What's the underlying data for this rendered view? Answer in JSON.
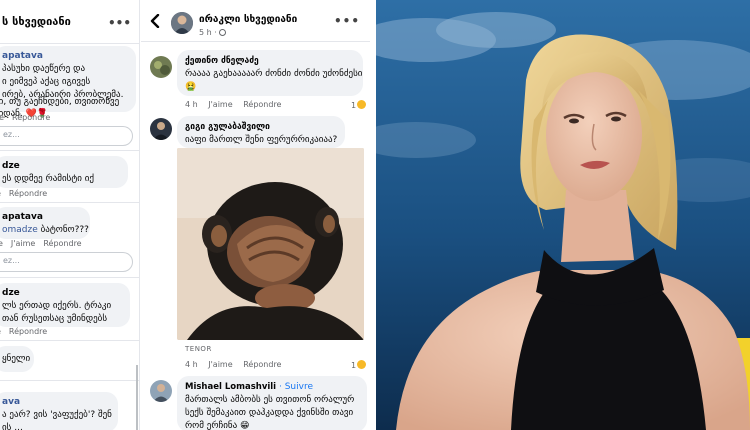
{
  "left": {
    "header_name": "ს სხვედიანი",
    "more": "•••",
    "comments": [
      {
        "who": "apatava",
        "lines": [
          "პასუხი დაეწერე და",
          "ი ეიმვეპ აქაც იგივეს",
          "ირებ, არანაირი პრობლემა.",
          "ბი, თუ გაეჩნდები, თვითონვე",
          "ეიდან."
        ],
        "emoji": "❤️🌹"
      },
      {
        "who": "dze",
        "lines": [
          "ეს დდმეე რამისტი იქ"
        ]
      },
      {
        "who": "apatava",
        "mention": "omadze",
        "lines": [
          "ბატონო???"
        ]
      },
      {
        "who": "dze",
        "lines": [
          "ლს ერთად იქერს. ტრაკი",
          "თან რუსეთსაც უმინდებს"
        ]
      },
      {
        "who": "ყნელი",
        "lines": []
      },
      {
        "who": "ava",
        "lines": [
          "ა ეარ? ვის 'ვაფუქებ'? შენ",
          "ის ..."
        ]
      }
    ],
    "actions": {
      "like": "J'aime",
      "reply": "Répondre"
    },
    "reply_placeholder": "ez..."
  },
  "mid": {
    "header": {
      "name": "ირაკლი სხვედიანი",
      "time": "5 h",
      "more": "•••"
    },
    "comments": [
      {
        "who": "ქეთინო ძნელაძე",
        "lines": [
          "რაააა გაეხააააარ ძონძი ძონძი უძონძესი"
        ],
        "emoji": "🤮",
        "time": "4 h",
        "reactions": "1"
      },
      {
        "who": "გიგი გულაბაშვილი",
        "lines": [
          "იაფი მართლ შენი ფერურრიკაიაა?"
        ]
      },
      {
        "who": "Mishael Lomashvili",
        "follow": "· Suivre",
        "lines": [
          "მართალს ამბობს ეს თვითონ ორალურ",
          "სექს შემაკაით დაჰკადდა ქვინსში თავი",
          "რომ ერჩინა"
        ],
        "emoji": "😁"
      }
    ],
    "gif_label": "TENOR",
    "gif_actions": {
      "time": "4 h",
      "like": "J'aime",
      "reply": "Répondre",
      "reactions": "1"
    },
    "actions": {
      "like": "J'aime",
      "reply": "Répondre"
    }
  },
  "colors": {
    "fb_blue": "#385898",
    "link_blue": "#1877f2",
    "bubble": "#f0f2f5",
    "muted": "#65676b",
    "studio_bg": "#123d66",
    "chair_yellow": "#f2d12b"
  }
}
